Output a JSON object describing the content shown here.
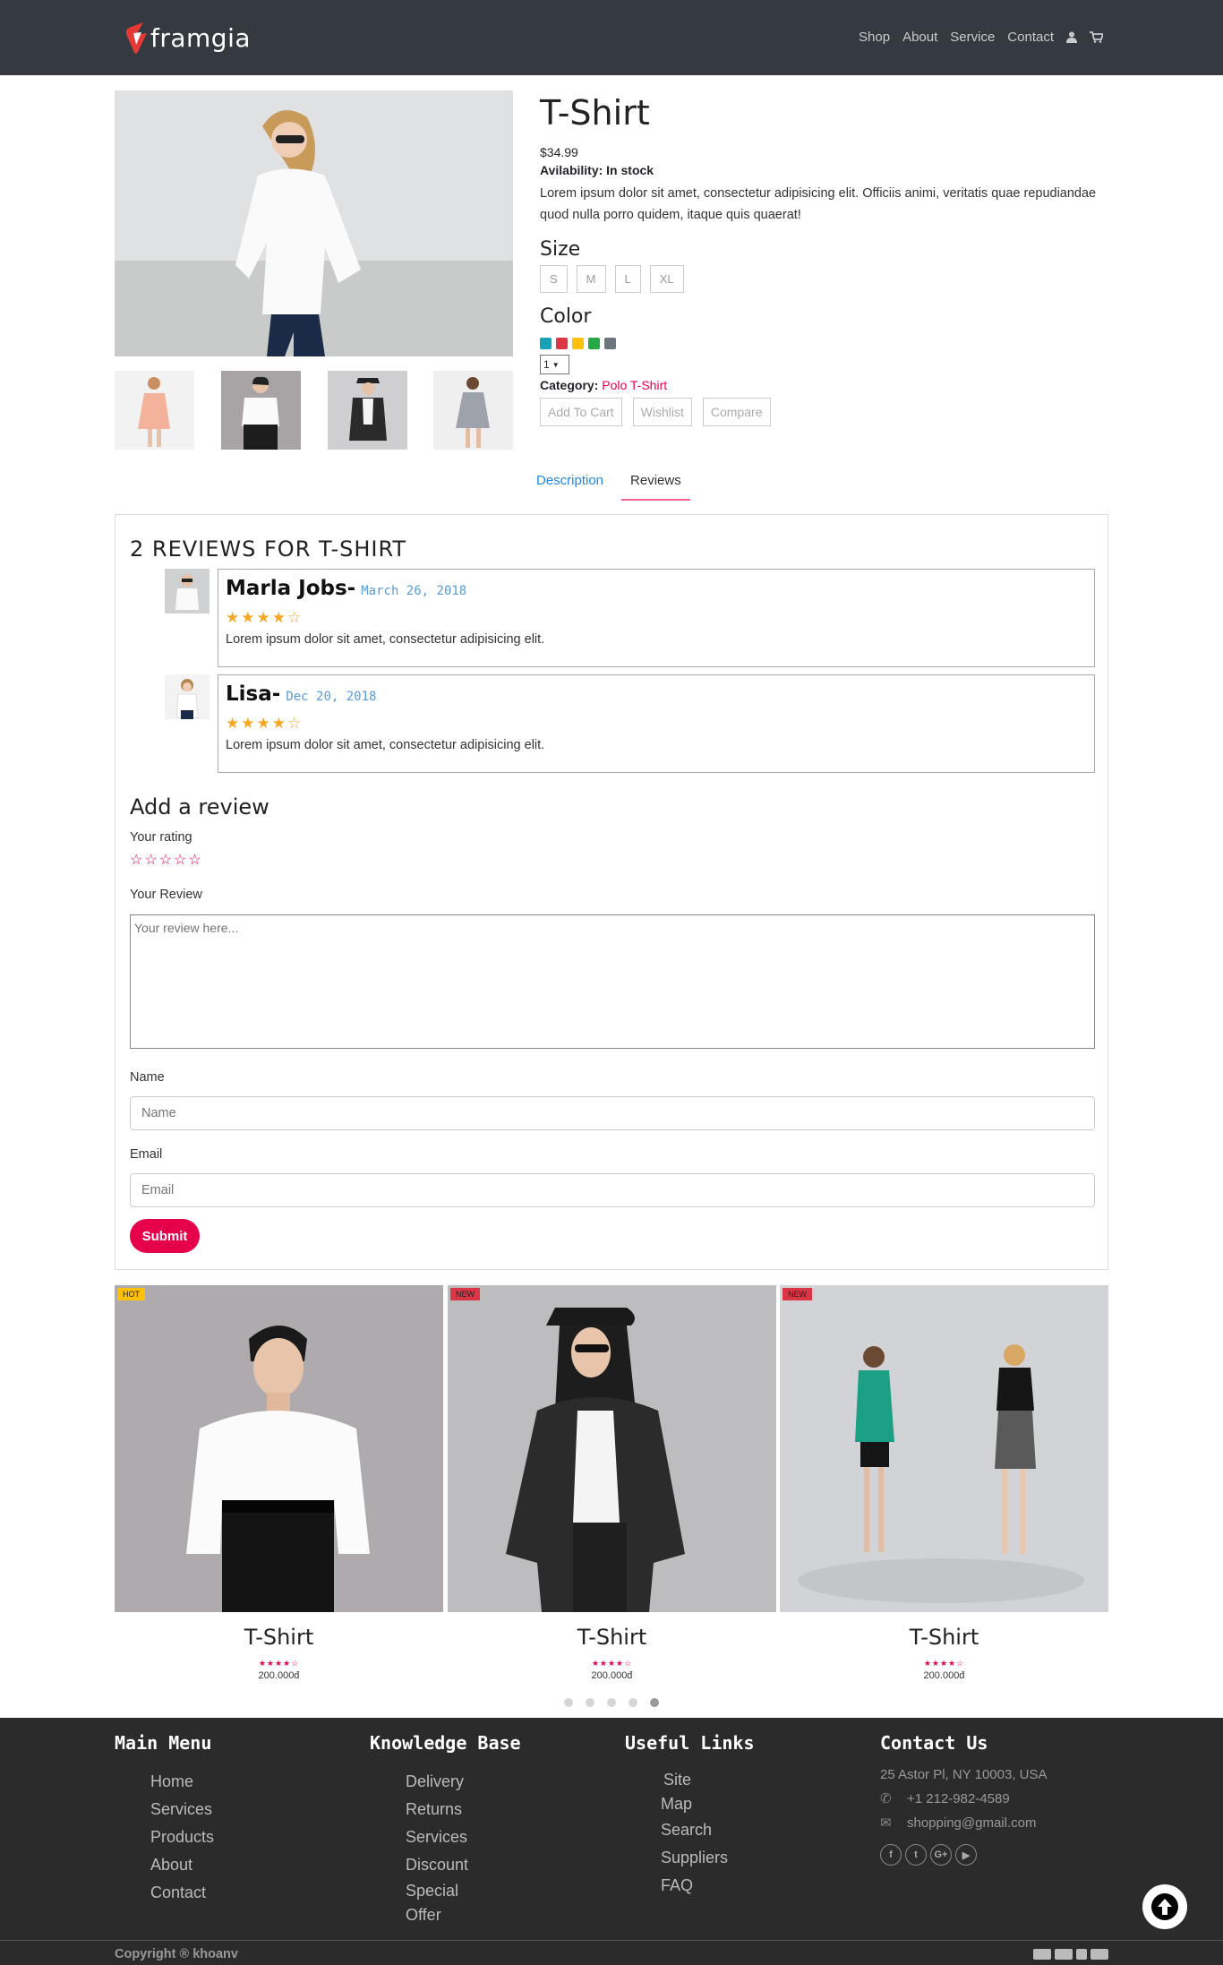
{
  "brand": {
    "name": "framgia",
    "logo_color": "#e53935"
  },
  "nav": {
    "items": [
      "Shop",
      "About",
      "Service",
      "Contact"
    ],
    "user_icon": "user-icon",
    "cart_icon": "cart-icon"
  },
  "product": {
    "title": "T-Shirt",
    "price": "$34.99",
    "availability": "Avilability: In stock",
    "description": "Lorem ipsum dolor sit amet, consectetur adipisicing elit. Officiis animi, veritatis quae repudiandae quod nulla porro quidem, itaque quis quaerat!",
    "size_label": "Size",
    "sizes": [
      "S",
      "M",
      "L",
      "XL"
    ],
    "color_label": "Color",
    "colors": [
      "#17a2b8",
      "#dc3545",
      "#ffc107",
      "#28a745",
      "#6c757d"
    ],
    "quantity": "1",
    "category_label": "Category:",
    "category_value": "Polo T-Shirt",
    "actions": {
      "add_to_cart": "Add To Cart",
      "wishlist": "Wishlist",
      "compare": "Compare"
    }
  },
  "tabs": {
    "description": "Description",
    "reviews": "Reviews"
  },
  "reviews": {
    "title": "2 REVIEWS FOR T-SHIRT",
    "items": [
      {
        "name": "Marla Jobs-",
        "date": "March 26, 2018",
        "stars": "★★★★☆",
        "rating": 4,
        "text": "Lorem ipsum dolor sit amet, consectetur adipisicing elit."
      },
      {
        "name": "Lisa-",
        "date": "Dec 20, 2018",
        "stars": "★★★★☆",
        "rating": 4,
        "text": "Lorem ipsum dolor sit amet, consectetur adipisicing elit."
      }
    ]
  },
  "review_form": {
    "title": "Add a review",
    "rating_label": "Your rating",
    "rating_stars": "☆☆☆☆☆",
    "review_label": "Your Review",
    "review_placeholder": "Your review here...",
    "name_label": "Name",
    "name_placeholder": "Name",
    "email_label": "Email",
    "email_placeholder": "Email",
    "submit": "Submit"
  },
  "related": {
    "items": [
      {
        "badge": "HOT",
        "badge_color": "#ffc107",
        "title": "T-Shirt",
        "stars": "★★★★☆",
        "rating": 4,
        "price": "200.000đ"
      },
      {
        "badge": "NEW",
        "badge_color": "#dc3545",
        "title": "T-Shirt",
        "stars": "★★★★☆",
        "rating": 4,
        "price": "200.000đ"
      },
      {
        "badge": "NEW",
        "badge_color": "#dc3545",
        "title": "T-Shirt",
        "stars": "★★★★☆",
        "rating": 4,
        "price": "200.000đ"
      }
    ],
    "active_dot": 5
  },
  "footer": {
    "main_menu": {
      "title": "Main Menu",
      "items": [
        "Home",
        "Services",
        "Products",
        "About",
        "Contact"
      ]
    },
    "knowledge": {
      "title": "Knowledge Base",
      "items": [
        "Delivery",
        "Returns",
        "Services",
        "Discount",
        "Special",
        "Offer"
      ]
    },
    "links": {
      "title": "Useful Links",
      "items": [
        "Site",
        "Map",
        "Search",
        "Suppliers",
        "FAQ"
      ]
    },
    "contact": {
      "title": "Contact Us",
      "address": "25 Astor Pl, NY 10003, USA",
      "phone": "+1 212-982-4589",
      "email": "shopping@gmail.com"
    },
    "copyright": "Copyright ® khoanv"
  }
}
